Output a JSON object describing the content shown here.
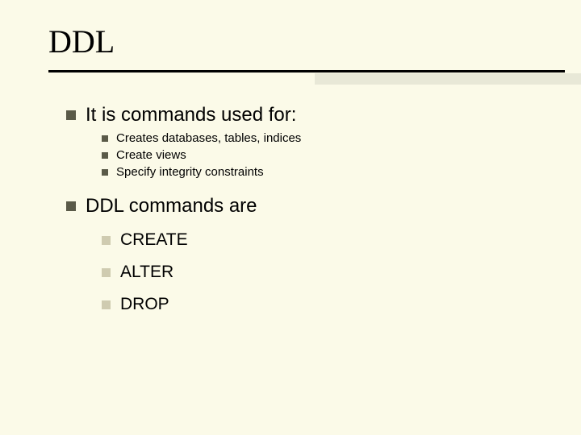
{
  "title": "DDL",
  "points": {
    "p1": {
      "text": "It is commands used for:",
      "sub": [
        "Creates databases, tables, indices",
        "Create views",
        "Specify integrity constraints"
      ]
    },
    "p2": {
      "text": "DDL commands are",
      "sub": [
        "CREATE",
        "ALTER",
        "DROP"
      ]
    }
  }
}
